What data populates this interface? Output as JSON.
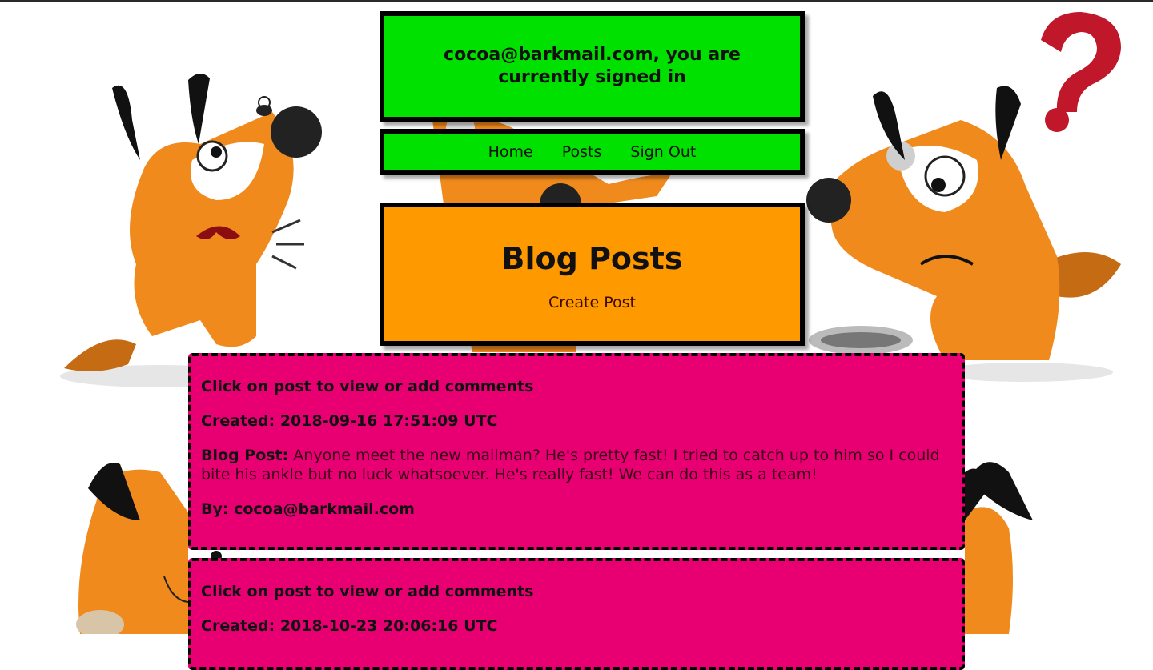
{
  "status": {
    "signed_in_message": "cocoa@barkmail.com, you are currently signed in"
  },
  "nav": {
    "items": [
      {
        "label": "Home"
      },
      {
        "label": "Posts"
      },
      {
        "label": "Sign Out"
      }
    ]
  },
  "header": {
    "title": "Blog Posts",
    "create_label": "Create Post"
  },
  "posts": [
    {
      "hint": "Click on post to view or add comments",
      "created_label": "Created:",
      "created": "2018-09-16 17:51:09 UTC",
      "body_label": "Blog Post:",
      "body": "Anyone meet the new mailman? He's pretty fast! I tried to catch up to him so I could bite his ankle but no luck whatsoever. He's really fast! We can do this as a team!",
      "by_label": "By:",
      "author": "cocoa@barkmail.com"
    },
    {
      "hint": "Click on post to view or add comments",
      "created_label": "Created:",
      "created": "2018-10-23 20:06:16 UTC"
    }
  ],
  "colors": {
    "green_panel": "#00e100",
    "orange_panel": "#ff9900",
    "post_pink": "#e80073",
    "dog_orange": "#f18a1c"
  },
  "icons": [
    "dog-illustration",
    "question-mark-icon",
    "fly-icon"
  ]
}
